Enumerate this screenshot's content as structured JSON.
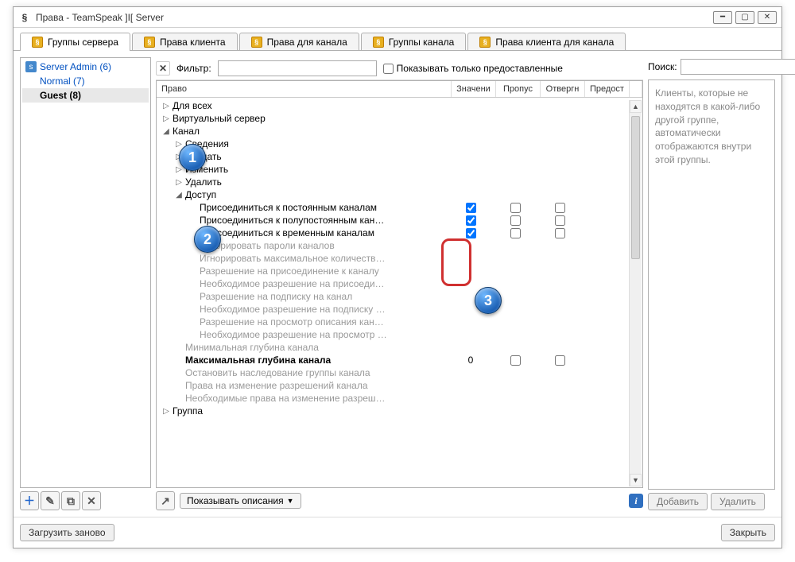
{
  "window": {
    "title": "Права - TeamSpeak ]I[ Server"
  },
  "tabs": [
    {
      "label": "Группы сервера",
      "active": true
    },
    {
      "label": "Права клиента"
    },
    {
      "label": "Права для канала"
    },
    {
      "label": "Группы канала"
    },
    {
      "label": "Права клиента для канала"
    }
  ],
  "groups": [
    {
      "label": "Server Admin (6)",
      "type": "admin"
    },
    {
      "label": "Normal (7)",
      "type": "normal"
    },
    {
      "label": "Guest (8)",
      "type": "guest",
      "selected": true
    }
  ],
  "filter": {
    "label": "Фильтр:",
    "show_granted": "Показывать только предоставленные"
  },
  "columns": {
    "name": "Право",
    "value": "Значени",
    "skip": "Пропус",
    "negate": "Отвергн",
    "grant": "Предост"
  },
  "tree": {
    "for_all": "Для всех",
    "vserver": "Виртуальный сервер",
    "channel": "Канал",
    "info": "Сведения",
    "create": "Создать",
    "modify": "Изменить",
    "delete": "Удалить",
    "access": "Доступ",
    "join_perm": "Присоединиться к постоянным каналам",
    "join_semi": "Присоединиться к полупостоянным кан…",
    "join_temp": "Присоединиться к временным каналам",
    "ign_pass": "Игнорировать пароли каналов",
    "ign_max": "Игнорировать максимальное количеств…",
    "perm_join": "Разрешение на присоединение к каналу",
    "need_join": "Необходимое разрешение на присоеди…",
    "perm_sub": "Разрешение на подписку на канал",
    "need_sub": "Необходимое разрешение на подписку …",
    "perm_desc": "Разрешение на просмотр описания кан…",
    "need_desc": "Необходимое разрешение на просмотр …",
    "min_depth": "Минимальная глубина канала",
    "max_depth": "Максимальная глубина канала",
    "max_depth_val": "0",
    "stop_inherit": "Остановить наследование группы канала",
    "perm_modify": "Права на изменение разрешений канала",
    "need_modify": "Необходимые права на изменение разреш…",
    "group": "Группа"
  },
  "desc_toggle": "Показывать описания",
  "search_label": "Поиск:",
  "right_hint": "Клиенты, которые не находятся в какой-либо другой группе, автоматически отображаются внутри этой группы.",
  "buttons": {
    "add": "Добавить",
    "remove": "Удалить",
    "reload": "Загрузить заново",
    "close": "Закрыть"
  },
  "bubbles": {
    "b1": "1",
    "b2": "2",
    "b3": "3"
  }
}
